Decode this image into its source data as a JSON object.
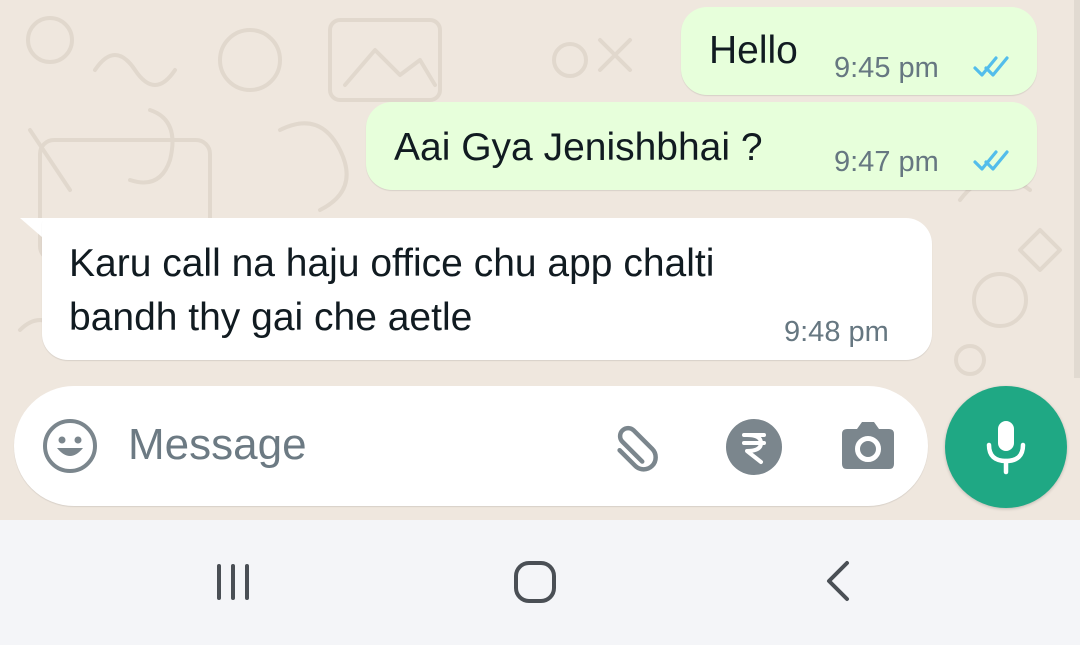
{
  "messages": [
    {
      "direction": "outgoing",
      "text": "Hello",
      "time": "9:45 pm",
      "status": "read"
    },
    {
      "direction": "outgoing",
      "text": "Aai Gya Jenishbhai ?",
      "time": "9:47 pm",
      "status": "read"
    },
    {
      "direction": "incoming",
      "lines": [
        "Karu call na haju office chu app chalti",
        "bandh thy gai che aetle"
      ],
      "time": "9:48 pm"
    }
  ],
  "composer": {
    "placeholder": "Message",
    "icons": [
      "emoji-icon",
      "attach-icon",
      "rupee-payment-icon",
      "camera-icon",
      "mic-icon"
    ]
  },
  "navbar": {
    "icons": [
      "recent-apps-icon",
      "home-icon",
      "back-icon"
    ]
  },
  "colors": {
    "chat_bg": "#efe7de",
    "outgoing_bubble": "#e7ffdb",
    "incoming_bubble": "#ffffff",
    "read_ticks": "#53bdeb",
    "accent": "#1fa884",
    "icon_gray": "#7b868d"
  }
}
